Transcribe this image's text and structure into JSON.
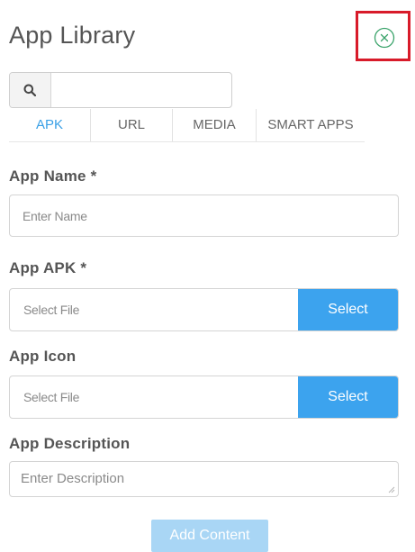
{
  "header": {
    "title": "App Library",
    "close_icon": "close-circle-icon",
    "close_color": "#3aa36a",
    "highlight_color": "#d81b2a"
  },
  "search": {
    "icon": "search-icon",
    "value": "",
    "placeholder": ""
  },
  "tabs": [
    {
      "label": "APK",
      "active": true
    },
    {
      "label": "URL",
      "active": false
    },
    {
      "label": "MEDIA",
      "active": false
    },
    {
      "label": "SMART APPS",
      "active": false
    }
  ],
  "form": {
    "app_name": {
      "label": "App Name *",
      "placeholder": "Enter Name",
      "value": ""
    },
    "app_apk": {
      "label": "App APK *",
      "file_text": "Select File",
      "button_label": "Select"
    },
    "app_icon": {
      "label": "App Icon",
      "file_text": "Select File",
      "button_label": "Select"
    },
    "app_description": {
      "label": "App Description",
      "placeholder": "Enter Description"
    }
  },
  "actions": {
    "add_label": "Add Content",
    "add_disabled": true
  },
  "colors": {
    "accent": "#3ca3ee",
    "accent_disabled": "#a9d6f5",
    "text": "#555555"
  }
}
